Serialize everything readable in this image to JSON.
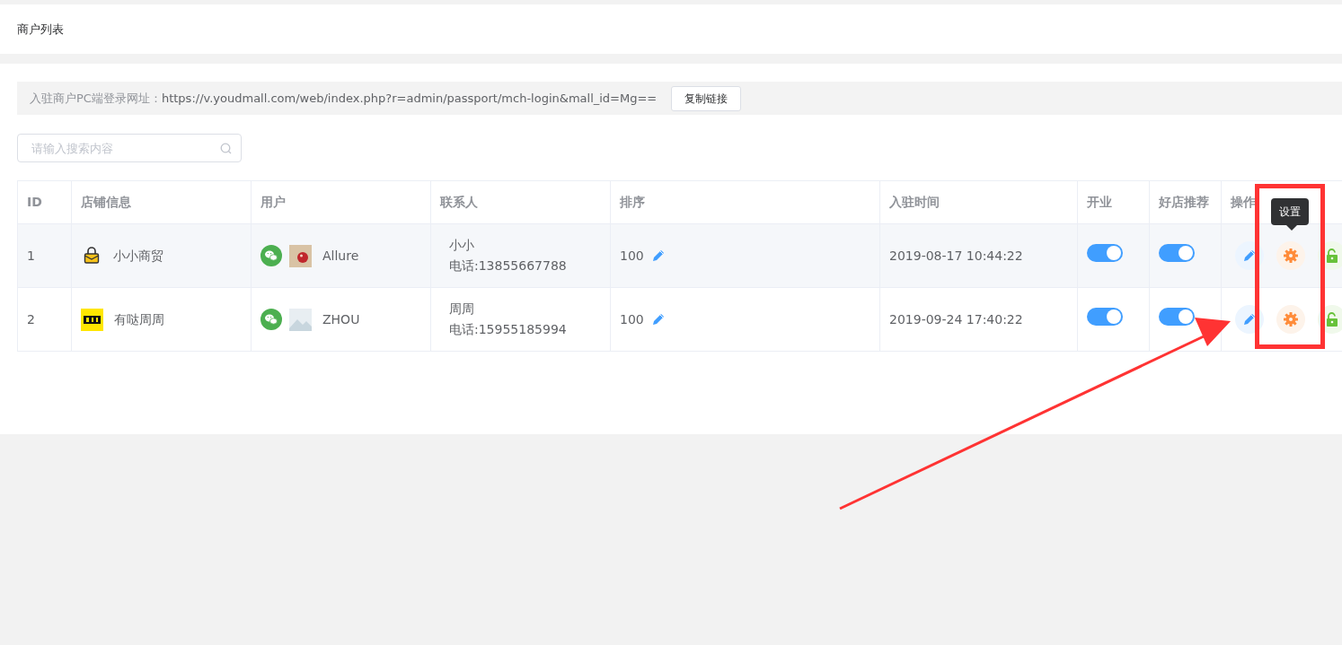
{
  "page_title": "商户列表",
  "login_url": {
    "label": "入驻商户PC端登录网址：",
    "url": "https://v.youdmall.com/web/index.php?r=admin/passport/mch-login&mall_id=Mg==",
    "button": "复制链接"
  },
  "search": {
    "placeholder": "请输入搜索内容"
  },
  "table": {
    "columns": [
      "ID",
      "店铺信息",
      "用户",
      "联系人",
      "排序",
      "入驻时间",
      "开业",
      "好店推荐",
      "操作"
    ],
    "rows": [
      {
        "id": "1",
        "store": {
          "logo": {
            "kind": "bag"
          },
          "name": "小小商贸"
        },
        "user": {
          "avatar": {
            "kind": "photo"
          },
          "name": "Allure"
        },
        "contact": {
          "name": "小小",
          "phone": "电话:13855667788"
        },
        "sort": "100",
        "joined": "2019-08-17 10:44:22",
        "open": true,
        "recommended": true
      },
      {
        "id": "2",
        "store": {
          "logo": {
            "kind": "brand"
          },
          "name": "有哒周周"
        },
        "user": {
          "avatar": {
            "kind": "picture"
          },
          "name": "ZHOU"
        },
        "contact": {
          "name": "周周",
          "phone": "电话:15955185994"
        },
        "sort": "100",
        "joined": "2019-09-24 17:40:22",
        "open": true,
        "recommended": true
      }
    ]
  },
  "tooltip": {
    "text": "设置"
  },
  "annotation": {
    "highlight_box": true,
    "arrow": true
  }
}
